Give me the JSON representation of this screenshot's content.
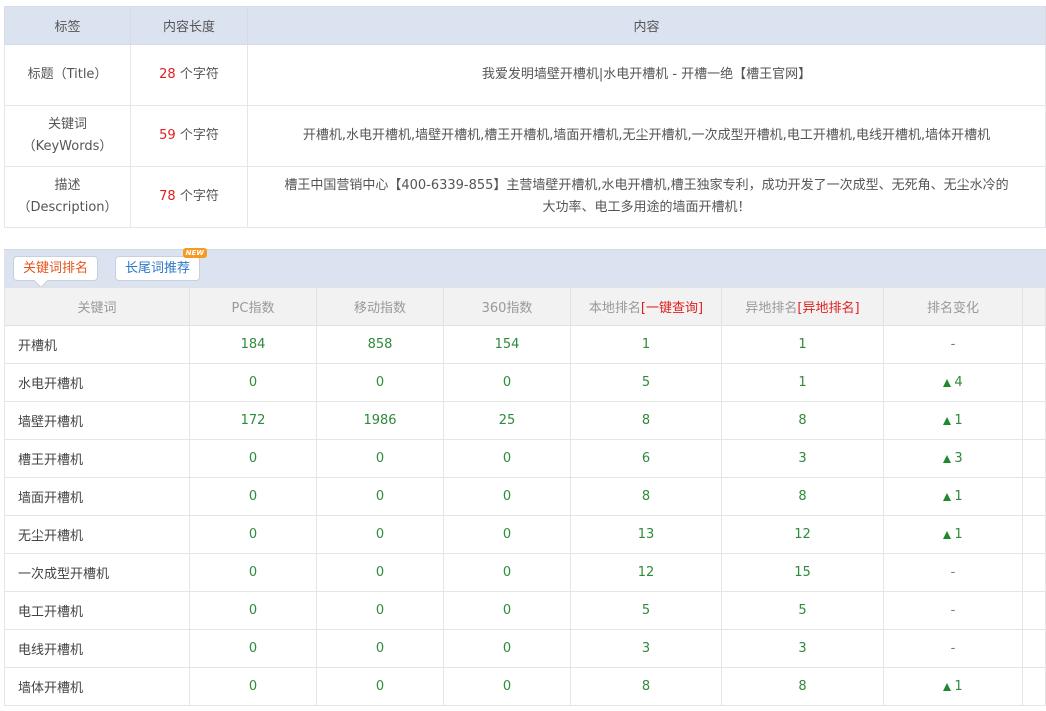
{
  "meta": {
    "headers": [
      "标签",
      "内容长度",
      "内容"
    ],
    "rows": [
      {
        "label": "标题（Title）",
        "label2": "",
        "count": "28",
        "unit": " 个字符",
        "content": "我爱发明墙壁开槽机|水电开槽机 - 开槽一绝【槽王官网】",
        "content2": ""
      },
      {
        "label": "关键词",
        "label2": "（KeyWords）",
        "count": "59",
        "unit": " 个字符",
        "content": "开槽机,水电开槽机,墙壁开槽机,槽王开槽机,墙面开槽机,无尘开槽机,一次成型开槽机,电工开槽机,电线开槽机,墙体开槽机",
        "content2": ""
      },
      {
        "label": "描述",
        "label2": "（Description）",
        "count": "78",
        "unit": " 个字符",
        "content": "槽王中国营销中心【400-6339-855】主营墙壁开槽机,水电开槽机,槽王独家专利，成功开发了一次成型、无死角、无尘水冷的",
        "content2": "大功率、电工多用途的墙面开槽机！"
      }
    ]
  },
  "tabs": {
    "active": "关键词排名",
    "second": "长尾词推荐",
    "badge": "NEW"
  },
  "ranking": {
    "headers": {
      "keyword": "关键词",
      "pc": "PC指数",
      "mobile": "移动指数",
      "i360": "360指数",
      "local": "本地排名",
      "local_link": "[一键查询]",
      "remote": "异地排名",
      "remote_link": "[异地排名]",
      "change": "排名变化"
    },
    "rows": [
      {
        "kw": "开槽机",
        "pc": "184",
        "mobile": "858",
        "i360": "154",
        "local": "1",
        "remote": "1",
        "change": "-",
        "up": false
      },
      {
        "kw": "水电开槽机",
        "pc": "0",
        "mobile": "0",
        "i360": "0",
        "local": "5",
        "remote": "1",
        "change": "4",
        "up": true
      },
      {
        "kw": "墙壁开槽机",
        "pc": "172",
        "mobile": "1986",
        "i360": "25",
        "local": "8",
        "remote": "8",
        "change": "1",
        "up": true
      },
      {
        "kw": "槽王开槽机",
        "pc": "0",
        "mobile": "0",
        "i360": "0",
        "local": "6",
        "remote": "3",
        "change": "3",
        "up": true
      },
      {
        "kw": "墙面开槽机",
        "pc": "0",
        "mobile": "0",
        "i360": "0",
        "local": "8",
        "remote": "8",
        "change": "1",
        "up": true
      },
      {
        "kw": "无尘开槽机",
        "pc": "0",
        "mobile": "0",
        "i360": "0",
        "local": "13",
        "remote": "12",
        "change": "1",
        "up": true
      },
      {
        "kw": "一次成型开槽机",
        "pc": "0",
        "mobile": "0",
        "i360": "0",
        "local": "12",
        "remote": "15",
        "change": "-",
        "up": false
      },
      {
        "kw": "电工开槽机",
        "pc": "0",
        "mobile": "0",
        "i360": "0",
        "local": "5",
        "remote": "5",
        "change": "-",
        "up": false
      },
      {
        "kw": "电线开槽机",
        "pc": "0",
        "mobile": "0",
        "i360": "0",
        "local": "3",
        "remote": "3",
        "change": "-",
        "up": false
      },
      {
        "kw": "墙体开槽机",
        "pc": "0",
        "mobile": "0",
        "i360": "0",
        "local": "8",
        "remote": "8",
        "change": "1",
        "up": true
      }
    ]
  },
  "colors": {
    "header_bg": "#dbe3f0",
    "count_red": "#e02020",
    "value_green": "#2e8b3a",
    "active_tab": "#e6531a",
    "link_blue": "#2d78c8"
  }
}
